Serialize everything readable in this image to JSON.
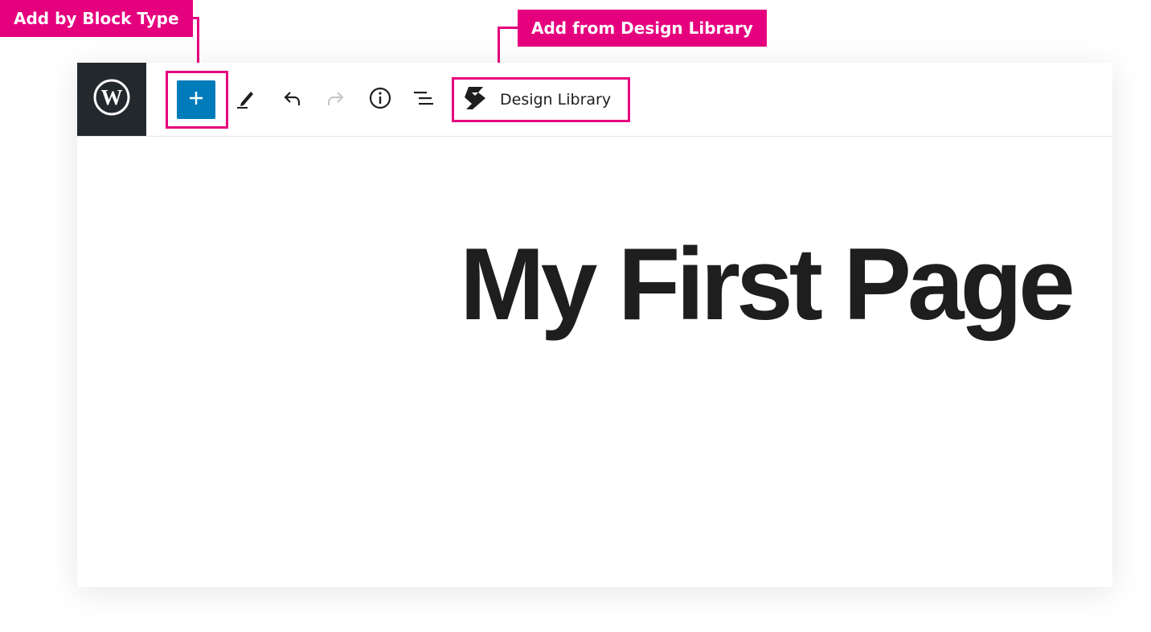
{
  "callouts": {
    "block_type": "Add by Block Type",
    "design_library": "Add from Design Library"
  },
  "toolbar": {
    "design_library_label": "Design Library",
    "add_button_symbol": "+"
  },
  "icons": [
    "wordpress-logo-icon",
    "plus-icon",
    "pencil-icon",
    "undo-icon",
    "redo-icon",
    "info-icon",
    "list-view-icon",
    "stackable-logo-icon"
  ],
  "colors": {
    "callout": "#e5007e",
    "primary_button": "#007cba",
    "wp_logo_bg": "#23282d",
    "redo_disabled": "#c8c8c8"
  },
  "content": {
    "page_title": "My First Page"
  }
}
